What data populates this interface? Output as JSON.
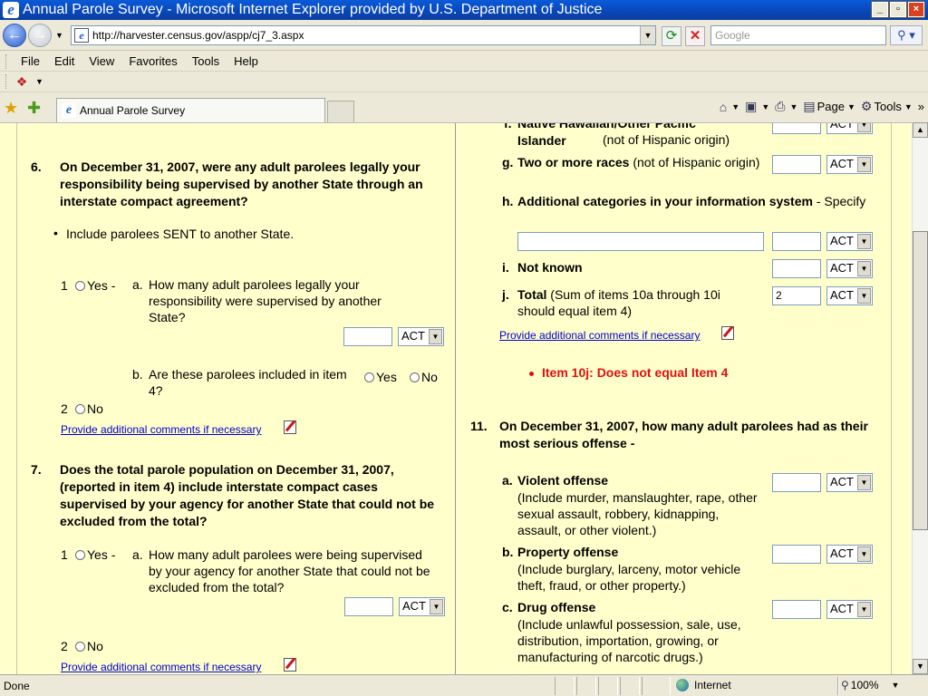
{
  "window": {
    "title": "Annual Parole Survey - Microsoft Internet Explorer provided by U.S. Department of Justice",
    "min": "_",
    "max": "▫",
    "close": "×"
  },
  "address": {
    "url": "http://harvester.census.gov/aspp/cj7_3.aspx",
    "search_placeholder": "Google"
  },
  "menu": [
    "File",
    "Edit",
    "View",
    "Favorites",
    "Tools",
    "Help"
  ],
  "tab": {
    "label": "Annual Parole Survey"
  },
  "commands": {
    "page": "Page",
    "tools": "Tools"
  },
  "left": {
    "q6": {
      "num": "6.",
      "text": "On December 31, 2007, were any adult parolees legally your responsibility being supervised by another State through an interstate compact agreement?",
      "bullet": "Include parolees SENT to another State.",
      "opt1": "1",
      "yes": "Yes -",
      "a_label": "a.",
      "a_text": "How many adult parolees legally your responsibility were supervised by another State?",
      "act": "ACT",
      "b_label": "b.",
      "b_text": "Are these parolees included in item 4?",
      "b_yes": "Yes",
      "b_no": "No",
      "opt2": "2",
      "no": "No",
      "link": "Provide additional comments if necessary"
    },
    "q7": {
      "num": "7.",
      "text": "Does the total parole population on December 31, 2007, (reported in item 4) include interstate compact cases supervised by your agency for another State that could not be excluded from the total?",
      "opt1": "1",
      "yes": "Yes -",
      "a_label": "a.",
      "a_text": "How many adult parolees were being supervised by your agency for another State that could not be excluded from the total?",
      "act": "ACT",
      "opt2": "2",
      "no": "No",
      "link": "Provide additional comments if necessary"
    }
  },
  "right": {
    "f": {
      "label": "f.",
      "title": "Native Hawaiian/Other Pacific Islander",
      "suffix": "(not of Hispanic origin)",
      "act": "ACT"
    },
    "g": {
      "label": "g.",
      "title": "Two or more races",
      "suffix": "(not of Hispanic origin)",
      "act": "ACT"
    },
    "h": {
      "label": "h.",
      "title": "Additional categories in your information system",
      "suffix": "- Specify",
      "act": "ACT"
    },
    "i": {
      "label": "i.",
      "title": "Not known",
      "act": "ACT"
    },
    "j": {
      "label": "j.",
      "title": "Total",
      "suffix": "(Sum of items 10a through 10i should equal item 4)",
      "value": "2",
      "act": "ACT"
    },
    "link": "Provide additional comments if necessary",
    "error": "Item 10j: Does not equal Item 4",
    "q11": {
      "num": "11.",
      "text": "On December 31, 2007, how many adult parolees had as their most serious offense -"
    },
    "a": {
      "label": "a.",
      "title": "Violent offense",
      "desc": "(Include murder, manslaughter, rape, other sexual assault, robbery, kidnapping, assault, or other violent.)",
      "act": "ACT"
    },
    "b": {
      "label": "b.",
      "title": "Property offense",
      "desc": "(Include burglary, larceny, motor vehicle theft, fraud, or other property.)",
      "act": "ACT"
    },
    "c": {
      "label": "c.",
      "title": "Drug offense",
      "desc": "(Include unlawful possession, sale, use, distribution, importation, growing, or manufacturing of narcotic drugs.)",
      "act": "ACT"
    }
  },
  "status": {
    "text": "Done",
    "zone": "Internet",
    "zoom": "100%"
  }
}
